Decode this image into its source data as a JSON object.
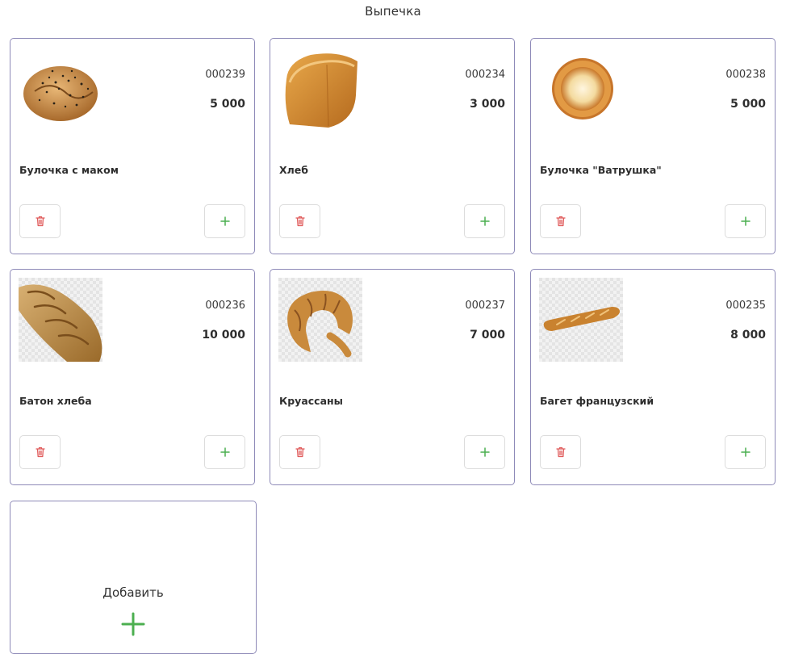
{
  "header": {
    "title": "Выпечка"
  },
  "colors": {
    "delete": "#e05a5a",
    "add": "#4caf50",
    "border": "#8e8ab8"
  },
  "products": [
    {
      "code": "000239",
      "price": "5 000",
      "name": "Булочка с маком",
      "image": "poppy-bun"
    },
    {
      "code": "000234",
      "price": "3 000",
      "name": "Хлеб",
      "image": "bread-loaf"
    },
    {
      "code": "000238",
      "price": "5 000",
      "name": "Булочка \"Ватрушка\"",
      "image": "vatrushka"
    },
    {
      "code": "000236",
      "price": "10 000",
      "name": "Батон хлеба",
      "image": "baton"
    },
    {
      "code": "000237",
      "price": "7 000",
      "name": "Круассаны",
      "image": "croissant"
    },
    {
      "code": "000235",
      "price": "8 000",
      "name": "Багет французский",
      "image": "baguette"
    }
  ],
  "add_card": {
    "label": "Добавить"
  }
}
